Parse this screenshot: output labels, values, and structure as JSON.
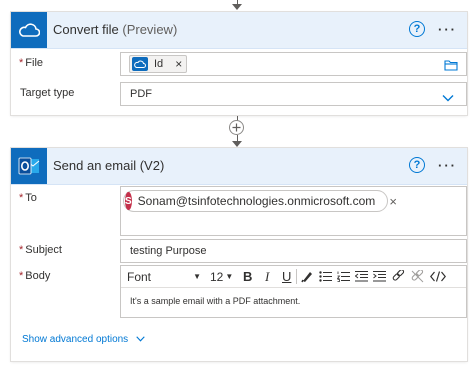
{
  "convert_card": {
    "title": "Convert file",
    "title_suffix": "(Preview)",
    "file_label": "File",
    "file_token": "Id",
    "target_type_label": "Target type",
    "target_type_value": "PDF"
  },
  "email_card": {
    "title": "Send an email (V2)",
    "to_label": "To",
    "to_avatar_letter": "S",
    "to_value": "Sonam@tsinfotechnologies.onmicrosoft.com",
    "subject_label": "Subject",
    "subject_value": "testing Purpose",
    "body_label": "Body",
    "toolbar": {
      "font": "Font",
      "font_size": "12",
      "bold": "B",
      "italic": "I",
      "underline": "U"
    },
    "body_value": "It's a sample email with a PDF attachment.",
    "advanced_link": "Show advanced options"
  },
  "common": {
    "help_glyph": "?",
    "more_glyph": "···",
    "required_mark": "*",
    "token_close": "×"
  },
  "colors": {
    "accent": "#0078d4",
    "header_bg": "#e8f1fb",
    "avatar": "#c4314b",
    "outlook_blue": "#0f6cbd"
  }
}
